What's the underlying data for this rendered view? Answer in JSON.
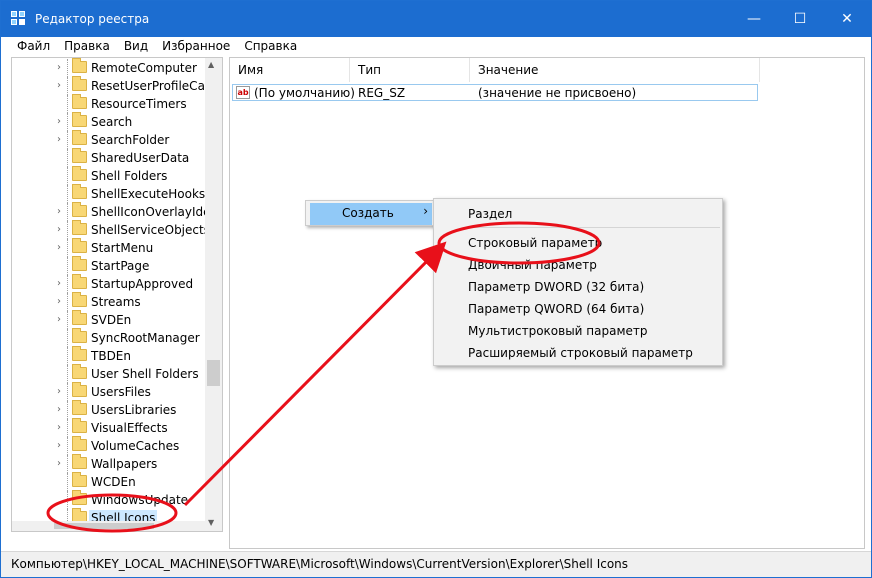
{
  "window": {
    "title": "Редактор реестра"
  },
  "window_buttons": {
    "minimize": "—",
    "maximize": "☐",
    "close": "✕"
  },
  "menubar": [
    "Файл",
    "Правка",
    "Вид",
    "Избранное",
    "Справка"
  ],
  "tree": {
    "items": [
      {
        "label": "RemoteComputer",
        "expandable": true
      },
      {
        "label": "ResetUserProfileCallba",
        "expandable": true
      },
      {
        "label": "ResourceTimers",
        "expandable": false
      },
      {
        "label": "Search",
        "expandable": true
      },
      {
        "label": "SearchFolder",
        "expandable": true
      },
      {
        "label": "SharedUserData",
        "expandable": false
      },
      {
        "label": "Shell Folders",
        "expandable": false
      },
      {
        "label": "ShellExecuteHooks",
        "expandable": false
      },
      {
        "label": "ShellIconOverlayIdent",
        "expandable": true
      },
      {
        "label": "ShellServiceObjects",
        "expandable": true
      },
      {
        "label": "StartMenu",
        "expandable": true
      },
      {
        "label": "StartPage",
        "expandable": false
      },
      {
        "label": "StartupApproved",
        "expandable": true
      },
      {
        "label": "Streams",
        "expandable": true
      },
      {
        "label": "SVDEn",
        "expandable": true
      },
      {
        "label": "SyncRootManager",
        "expandable": false
      },
      {
        "label": "TBDEn",
        "expandable": false
      },
      {
        "label": "User Shell Folders",
        "expandable": false
      },
      {
        "label": "UsersFiles",
        "expandable": true
      },
      {
        "label": "UsersLibraries",
        "expandable": true
      },
      {
        "label": "VisualEffects",
        "expandable": true
      },
      {
        "label": "VolumeCaches",
        "expandable": true
      },
      {
        "label": "Wallpapers",
        "expandable": true
      },
      {
        "label": "WCDEn",
        "expandable": false
      },
      {
        "label": "WindowsUpdate",
        "expandable": false
      },
      {
        "label": "Shell Icons",
        "expandable": false,
        "selected": true
      }
    ]
  },
  "columns": {
    "name": "Имя",
    "type": "Тип",
    "value": "Значение"
  },
  "rows": [
    {
      "icon": "ab",
      "name": "(По умолчанию)",
      "type": "REG_SZ",
      "value": "(значение не присвоено)"
    }
  ],
  "context_menu": {
    "create": "Создать",
    "arrow": "›"
  },
  "submenu": {
    "items": [
      "Раздел",
      "Строковый параметр",
      "Двоичный параметр",
      "Параметр DWORD (32 бита)",
      "Параметр QWORD (64 бита)",
      "Мультистроковый параметр",
      "Расширяемый строковый параметр"
    ]
  },
  "statusbar": {
    "path": "Компьютер\\HKEY_LOCAL_MACHINE\\SOFTWARE\\Microsoft\\Windows\\CurrentVersion\\Explorer\\Shell Icons"
  },
  "colors": {
    "titlebar": "#1c6dd0",
    "annotation": "#e8101a",
    "highlight": "#91c9f7"
  }
}
